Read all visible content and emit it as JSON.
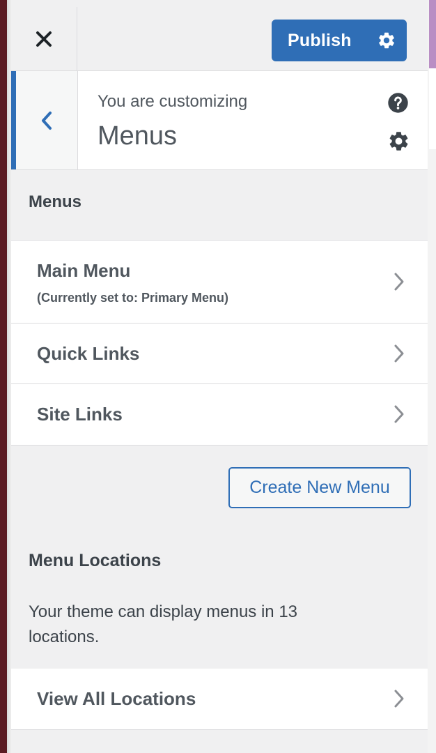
{
  "header": {
    "close_icon": "close-icon",
    "publish_label": "Publish",
    "publish_settings_icon": "gear-icon",
    "publish_color": "#2f6eb6"
  },
  "info": {
    "customizing_label": "You are customizing",
    "section_title": "Menus",
    "back_icon": "chevron-left-icon",
    "help_icon": "help-icon",
    "settings_icon": "gear-icon"
  },
  "menus_section": {
    "heading": "Menus",
    "items": [
      {
        "label": "Main Menu",
        "sublabel": "(Currently set to: Primary Menu)"
      },
      {
        "label": "Quick Links"
      },
      {
        "label": "Site Links"
      }
    ],
    "create_button": "Create New Menu"
  },
  "locations": {
    "heading": "Menu Locations",
    "description": "Your theme can display menus in 13 locations.",
    "view_all_label": "View All Locations"
  }
}
